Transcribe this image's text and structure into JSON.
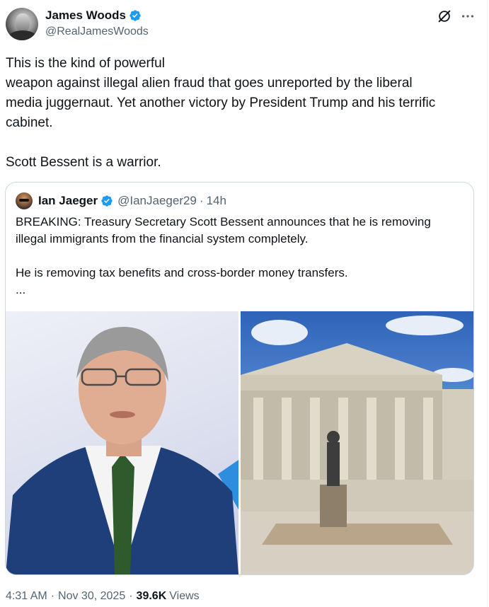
{
  "author": {
    "name": "James Woods",
    "handle": "@RealJamesWoods"
  },
  "post": {
    "lines": [
      "This is the kind of powerful",
      "weapon against illegal alien fraud that goes unreported by the liberal",
      "media juggernaut. Yet another victory by President Trump and his terrific",
      "cabinet."
    ],
    "closing_line": "Scott Bessent is a warrior."
  },
  "quote": {
    "name": "Ian Jaeger",
    "handle": "@IanJaeger29",
    "separator": "·",
    "time": "14h",
    "lines": [
      "BREAKING: Treasury Secretary Scott Bessent announces that he is removing",
      "illegal immigrants from the financial system completely."
    ],
    "line2": "He is removing tax benefits and cross-border money transfers.",
    "ellipsis": "..."
  },
  "meta": {
    "time": "4:31 AM",
    "sep1": "·",
    "date": "Nov 30, 2025",
    "sep2": "·",
    "views_count": "39.6K",
    "views_label": "Views"
  },
  "icons": {
    "verified": "verified-badge-icon",
    "grok": "grok-icon",
    "more": "more-icon"
  },
  "colors": {
    "verified_blue": "#1d9bf0",
    "secondary_text": "#536471",
    "border": "#cfd9de"
  }
}
